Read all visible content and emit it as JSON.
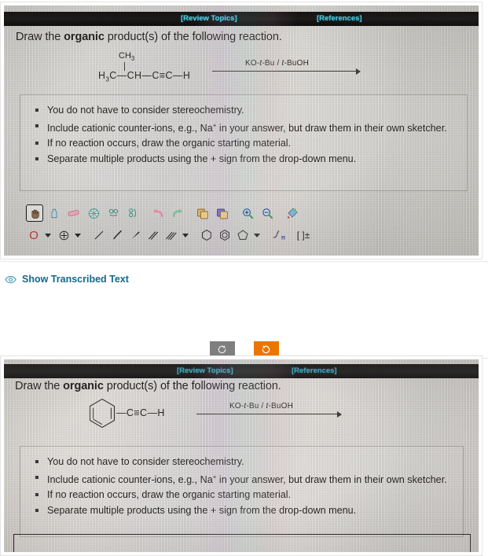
{
  "page": {
    "transcribe_link": {
      "label": "Show Transcribed Text",
      "icon": "eye-icon",
      "color": "#16688a"
    },
    "rotate_controls": {
      "ccw_label": "↺",
      "cw_label": "↻",
      "ccw_color": "#7f7f7f",
      "cw_color": "#ea7600"
    }
  },
  "question_1": {
    "tabs": {
      "review": "[Review Topics]",
      "references": "[References]",
      "tab_color": "#3fd3e8"
    },
    "prompt": {
      "before": "Draw the ",
      "bold": "organic",
      "after": " product(s) of the following reaction."
    },
    "reaction": {
      "substrate_label": "H3C-CH-C≡C-H",
      "substrate_parts": {
        "a": "H",
        "a_sub": "3",
        "b": "C",
        "chain": "—CH—C≡C—H"
      },
      "branch_label": "CH",
      "branch_sub": "3",
      "reagent_plain": "KO-t-Bu / t-BuOH",
      "reagent": {
        "p1": "KO-",
        "i1": "t",
        "p2": "-Bu / ",
        "i2": "t",
        "p3": "-BuOH"
      }
    },
    "instructions": [
      "You do not have to consider stereochemistry.",
      "Include cationic counter-ions, e.g., Na",
      "If no reaction occurs, draw the organic starting material.",
      "Separate multiple products using the + sign from the drop-down menu."
    ],
    "instruction_2": {
      "pre": "Include cationic counter-ions, e.g., Na",
      "sup": "+",
      "post": " in your answer, but draw them in their own sketcher."
    },
    "sketcher": {
      "row1_tools": [
        {
          "name": "hand-pan-tool",
          "glyph": "✋",
          "selected": true
        },
        {
          "name": "lasso-select-tool",
          "glyph": "☂",
          "selected": false
        },
        {
          "name": "eraser-tool",
          "glyph": "▰",
          "selected": false
        },
        {
          "name": "rotate-3d-tool",
          "glyph": "✹",
          "selected": false
        },
        {
          "name": "flip-horizontal-tool",
          "glyph": "⚭",
          "selected": false
        },
        {
          "name": "flip-vertical-tool",
          "glyph": "⚮",
          "selected": false
        },
        {
          "name": "undo-tool",
          "glyph": "↶",
          "selected": false
        },
        {
          "name": "redo-tool",
          "glyph": "↷",
          "selected": false
        },
        {
          "name": "copy-tool",
          "glyph": "⧉",
          "selected": false
        },
        {
          "name": "paste-tool",
          "glyph": "❐",
          "selected": false
        },
        {
          "name": "zoom-in-tool",
          "glyph": "⊕",
          "selected": false
        },
        {
          "name": "zoom-out-tool",
          "glyph": "⊖",
          "selected": false
        },
        {
          "name": "clean-structure-tool",
          "glyph": "✄",
          "selected": false
        }
      ],
      "row2_tools": [
        {
          "name": "atom-oxygen-tool",
          "glyph": "O",
          "color": "#c0392b"
        },
        {
          "name": "charge-tool",
          "glyph": "⊕",
          "color": "#2a2826"
        },
        {
          "name": "single-bond-tool",
          "glyph": "/",
          "color": "#2a2826"
        },
        {
          "name": "hashed-wedge-bond-tool",
          "glyph": "⫴",
          "color": "#2a2826"
        },
        {
          "name": "solid-wedge-bond-tool",
          "glyph": "◥",
          "color": "#2a2826"
        },
        {
          "name": "double-bond-tool",
          "glyph": "//",
          "color": "#2a2826"
        },
        {
          "name": "triple-bond-tool",
          "glyph": "///",
          "color": "#2a2826"
        },
        {
          "name": "cyclohexane-ring-tool",
          "glyph": "⬡",
          "color": "#2a2826"
        },
        {
          "name": "benzene-ring-tool",
          "glyph": "⌬",
          "color": "#2a2826"
        },
        {
          "name": "cyclopentane-ring-tool",
          "glyph": "⬠",
          "color": "#2a2826"
        },
        {
          "name": "chain-tool",
          "glyph": "∫",
          "color": "#2a2826"
        },
        {
          "name": "bracket-charge-tool",
          "glyph": "[ ]±",
          "color": "#2a2826"
        }
      ],
      "atom_label": "O",
      "chain_label": "n",
      "bracket_label": "[ ]±"
    }
  },
  "question_2": {
    "tabs": {
      "review": "[Review Topics]",
      "references": "[References]",
      "tab_color": "#2f9fb5"
    },
    "prompt": {
      "before": "Draw the ",
      "bold": "organic",
      "after": " product(s) of the following reaction."
    },
    "reaction": {
      "substrate_label": "Ph-C≡C-H",
      "substrate_tail": "—C≡C—H",
      "ring": "benzene-ring",
      "reagent_plain": "KO-t-Bu / t-BuOH",
      "reagent": {
        "p1": "KO-",
        "i1": "t",
        "p2": "-Bu / ",
        "i2": "t",
        "p3": "-BuOH"
      }
    },
    "instructions": [
      "You do not have to consider stereochemistry.",
      "Include cationic counter-ions, e.g., Na",
      "If no reaction occurs, draw the organic starting material.",
      "Separate multiple products using the + sign from the drop-down menu."
    ],
    "instruction_2": {
      "pre": "Include cationic counter-ions, e.g., Na",
      "sup": "+",
      "post": " in your answer, but draw them in their own sketcher."
    }
  }
}
